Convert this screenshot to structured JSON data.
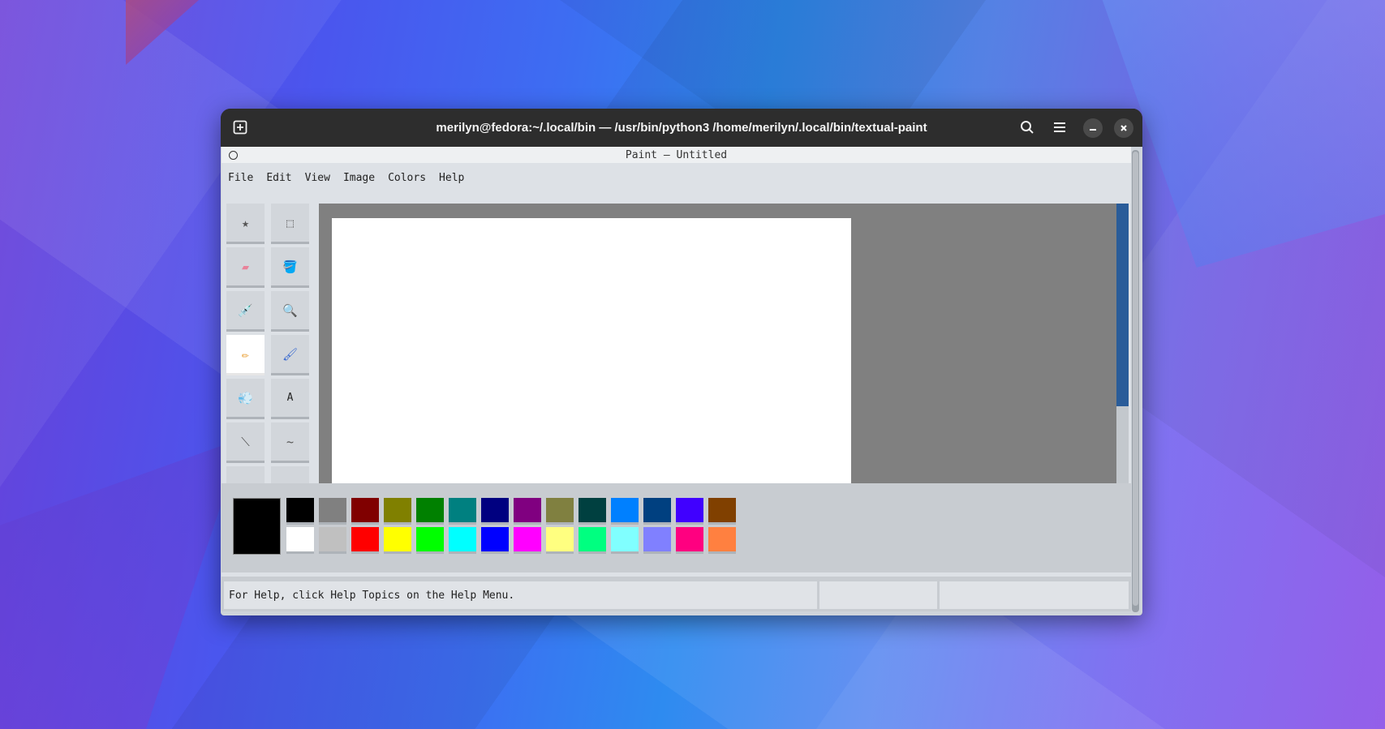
{
  "window": {
    "title": "merilyn@fedora:~/.local/bin — /usr/bin/python3 /home/merilyn/.local/bin/textual-paint"
  },
  "app": {
    "title": "Paint — Untitled",
    "menu": [
      "File",
      "Edit",
      "View",
      "Image",
      "Colors",
      "Help"
    ]
  },
  "tools": [
    {
      "name": "free-form-select",
      "glyph": "★"
    },
    {
      "name": "rect-select",
      "glyph": "⬚"
    },
    {
      "name": "eraser",
      "glyph": "▰"
    },
    {
      "name": "fill-bucket",
      "glyph": "🪣"
    },
    {
      "name": "pick-color",
      "glyph": "💉"
    },
    {
      "name": "magnifier",
      "glyph": "🔍"
    },
    {
      "name": "pencil",
      "glyph": "✏"
    },
    {
      "name": "brush",
      "glyph": "🖌"
    },
    {
      "name": "airbrush",
      "glyph": "💨"
    },
    {
      "name": "text",
      "glyph": "A"
    },
    {
      "name": "line",
      "glyph": "⟍"
    },
    {
      "name": "curve",
      "glyph": "~"
    }
  ],
  "selected_tool": "pencil",
  "palette": {
    "primary": "#000000",
    "top": [
      "#000000",
      "#808080",
      "#800000",
      "#808000",
      "#008000",
      "#008080",
      "#000080",
      "#800080",
      "#808040",
      "#004040",
      "#0080ff",
      "#004080",
      "#4000ff",
      "#804000"
    ],
    "bottom": [
      "#ffffff",
      "#c0c0c0",
      "#ff0000",
      "#ffff00",
      "#00ff00",
      "#00ffff",
      "#0000ff",
      "#ff00ff",
      "#ffff80",
      "#00ff80",
      "#80ffff",
      "#8080ff",
      "#ff0080",
      "#ff8040"
    ]
  },
  "status": {
    "help_text": "For Help, click Help Topics on the Help Menu.",
    "coords": "",
    "size": ""
  }
}
